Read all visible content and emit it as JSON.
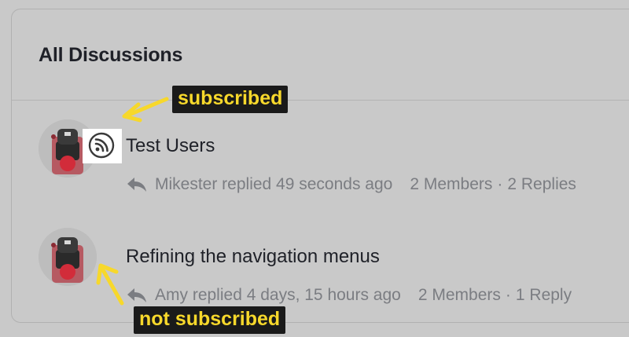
{
  "panel": {
    "title": "All Discussions"
  },
  "discussions": [
    {
      "title": "Test Users",
      "subscribed": true,
      "subscribed_icon": "rss-feed-icon",
      "reply_icon": "reply-arrow-icon",
      "last_reply": "Mikester replied 49 seconds ago",
      "members": "2 Members",
      "separator": "·",
      "replies": "2 Replies"
    },
    {
      "title": "Refining the navigation menus",
      "subscribed": false,
      "reply_icon": "reply-arrow-icon",
      "last_reply": "Amy replied 4 days, 15 hours ago",
      "members": "2 Members",
      "separator": "·",
      "replies": "1 Reply"
    }
  ],
  "annotations": {
    "subscribed_label": "subscribed",
    "not_subscribed_label": "not subscribed",
    "label_text_color": "#f7d82b",
    "label_background": "#1a1a1a",
    "arrow_color": "#f7d82b"
  }
}
